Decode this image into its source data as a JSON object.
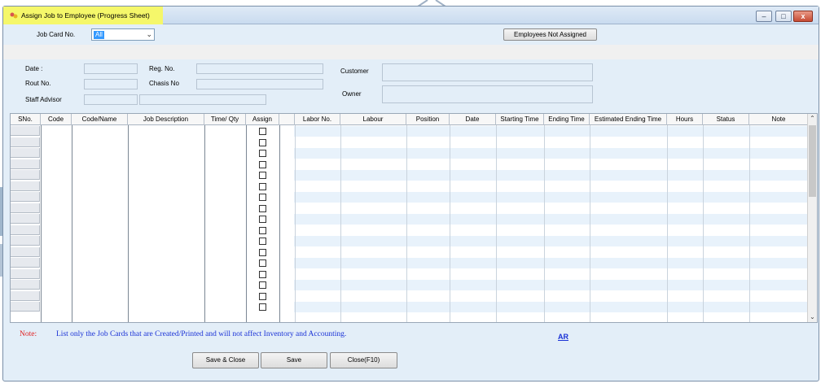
{
  "window": {
    "title": "Assign Job to Employee (Progress Sheet)",
    "minimize_glyph": "–",
    "maximize_glyph": "□",
    "close_glyph": "x"
  },
  "job_card": {
    "label": "Job Card No.",
    "value": "All"
  },
  "employees_not_assigned_button": "Employees Not Assigned",
  "fields": {
    "date_label": "Date :",
    "rout_no_label": "Rout No.",
    "staff_advisor_label": "Staff Advisor",
    "reg_no_label": "Reg. No.",
    "chasis_no_label": "Chasis No",
    "customer_label": "Customer",
    "owner_label": "Owner"
  },
  "grid": {
    "columns": [
      "SNo.",
      "Code",
      "Code/Name",
      "Job Description",
      "Time/ Qty",
      "Assign",
      "",
      "Labor No.",
      "Labour",
      "Position",
      "Date",
      "Starting Time",
      "Ending Time",
      "Estimated Ending Time",
      "Hours",
      "Status",
      "Note"
    ],
    "row_count": 17
  },
  "note": {
    "label": "Note:",
    "text": "List only the Job Cards that are Created/Printed and will not affect Inventory and Accounting."
  },
  "ar_link": "AR",
  "buttons": {
    "save_close": "Save & Close",
    "save": "Save",
    "close": "Close(F10)"
  },
  "colors": {
    "window_bg": "#e3eef8",
    "title_highlight": "#f5f76a",
    "note_label": "#e02020",
    "note_text": "#1a32d6"
  }
}
